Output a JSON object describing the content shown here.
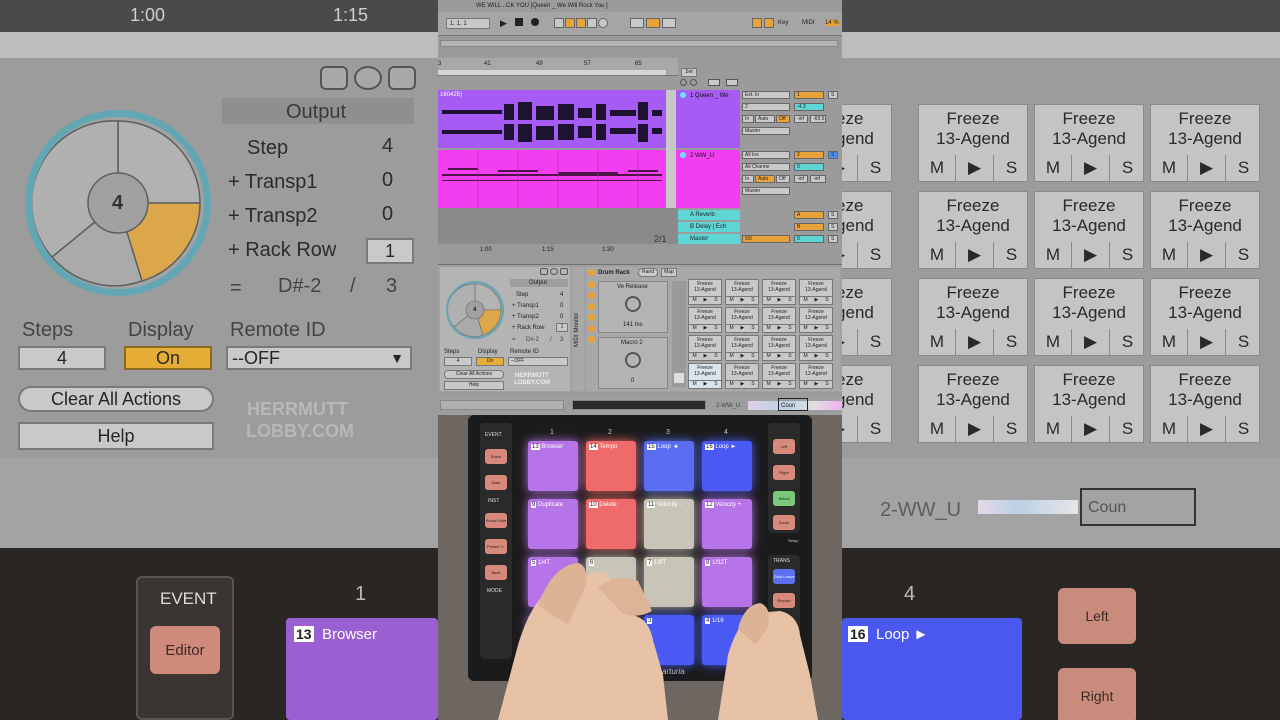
{
  "window": {
    "title": "WE WILL ..CK YOU  [Queen _ We Will Rock You ]"
  },
  "transport": {
    "position": "1.   1.   1",
    "key_label": "Key",
    "midi_label": "MIDI",
    "cpu": "14 %"
  },
  "timeline": {
    "ticks": [
      "3",
      "41",
      "49",
      "57",
      "65"
    ],
    "set_label": "Set",
    "bg_ticks": [
      "1:00",
      "1:15"
    ]
  },
  "arrangement": {
    "clip1_label": "160425)",
    "time_ticks": [
      "1:00",
      "1:15",
      "1:30"
    ],
    "fraction": "2/1"
  },
  "tracks": [
    {
      "name": "1 Queen _ We",
      "input": "Ext. In",
      "channel": "2",
      "vol": "-4.3",
      "mon_in": "In",
      "mon_auto": "Auto",
      "mon_off": "Off",
      "peak1": "-inf",
      "peak2": "-69.5",
      "out": "Master",
      "num": "1",
      "solo": "S"
    },
    {
      "name": "2 WW_U",
      "input": "All Ins",
      "channel": "All Channe",
      "vol": "0",
      "mon_in": "In",
      "mon_auto": "Auto",
      "mon_off": "Off",
      "peak1": "-inf",
      "peak2": "-inf",
      "out": "Master",
      "num": "2",
      "solo": "S"
    }
  ],
  "returns": [
    {
      "name": "A Reverb",
      "letter": "A",
      "solo": "S"
    },
    {
      "name": "B Delay | Ech",
      "letter": "B",
      "solo": "S"
    },
    {
      "name": "Master",
      "sends": "5/6",
      "vol": "0",
      "solo": "S"
    }
  ],
  "device": {
    "output_title": "Output",
    "rows": [
      {
        "label": "Step",
        "value": "4"
      },
      {
        "label": "+ Transp1",
        "value": "0"
      },
      {
        "label": "+ Transp2",
        "value": "0"
      },
      {
        "label": "+ Rack Row",
        "value": "1"
      }
    ],
    "note": "= D#-2 / 3",
    "note_name": "D#-2",
    "note_sep": "/",
    "note_num": "3",
    "eq": "=",
    "dial_value": "4",
    "steps_label": "Steps",
    "steps_value": "4",
    "display_label": "Display",
    "display_value": "On",
    "remote_label": "Remote ID",
    "remote_value": "--OFF",
    "clear_label": "Clear All Actions",
    "help_label": "Help",
    "brand_line1": "HERRMUTT",
    "brand_line2": "LOBBY.COM",
    "side_label": "MIDI Monitor"
  },
  "drum_rack": {
    "title": "Drum Rack",
    "rand": "Rand",
    "map": "Map",
    "macro1": "Ve Release",
    "macro1_value": "141 ms",
    "macro2": "Macro 2",
    "macro2_value": "0",
    "pad_name": "Freeze 13-Agend",
    "pad_top": "Freeze",
    "pad_bot": "13-Agend",
    "m": "M",
    "s": "S"
  },
  "bottom_bar": {
    "track": "2-WW_U",
    "count": "Coun"
  },
  "hardware": {
    "col_numbers": [
      "1",
      "2",
      "3",
      "4"
    ],
    "pads": [
      {
        "num": "13",
        "label": "Browser",
        "color": "#b774e8"
      },
      {
        "num": "14",
        "label": "Tempo",
        "color": "#ef6a6a"
      },
      {
        "num": "15",
        "label": "Loop ◄",
        "color": "#5a6cf2"
      },
      {
        "num": "16",
        "label": "Loop ►",
        "color": "#4a5af5"
      },
      {
        "num": "9",
        "label": "Duplicate",
        "color": "#b774e8"
      },
      {
        "num": "10",
        "label": "Delete",
        "color": "#ef6a6a"
      },
      {
        "num": "11",
        "label": "Velocity -",
        "color": "#c8c4b8"
      },
      {
        "num": "12",
        "label": "Velocity +",
        "color": "#b774e8"
      },
      {
        "num": "5",
        "label": "1/4T",
        "color": "#b774e8"
      },
      {
        "num": "6",
        "label": "",
        "color": "#c8c4b8"
      },
      {
        "num": "7",
        "label": "1/8T",
        "color": "#c8c4b8"
      },
      {
        "num": "8",
        "label": "1/32T",
        "color": "#b774e8"
      },
      {
        "num": "1",
        "label": "",
        "color": "#b774e8"
      },
      {
        "num": "2",
        "label": "",
        "color": "#c8c4b8"
      },
      {
        "num": "3",
        "label": "",
        "color": "#4a5af5"
      },
      {
        "num": "4",
        "label": "1/16",
        "color": "#4a5af5"
      }
    ],
    "left_sections": [
      "EVENT",
      "INST",
      "MODE"
    ],
    "left_buttons": [
      "Editor",
      "Mute Quantize",
      "Show/ Hide",
      "Preset +/- Next",
      "Bank"
    ],
    "right_buttons": [
      "Left",
      "Right",
      "Select",
      "Zoom"
    ],
    "setup": "Setup",
    "trans_label": "TRANS",
    "trans_buttons": [
      "Click Loops",
      "Record Start"
    ],
    "brand": "arturia"
  },
  "zoom_left": {
    "output": "Output",
    "step": "Step",
    "step_v": "4",
    "t1": "+ Transp1",
    "t1_v": "0",
    "t2": "+ Transp2",
    "t2_v": "0",
    "rr": "+ Rack Row",
    "rr_v": "1",
    "eq": "=",
    "note": "D#-2",
    "sep": "/",
    "num": "3",
    "dial": "4",
    "steps": "Steps",
    "display": "Display",
    "remote": "Remote ID",
    "steps_v": "4",
    "display_v": "On",
    "remote_v": "--OFF",
    "clear": "Clear All Actions",
    "help": "Help",
    "brand1": "HERRMUTT",
    "brand2": "LOBBY.COM",
    "event": "EVENT",
    "editor": "Editor",
    "one": "1",
    "browser": "Browser",
    "thirteen": "13"
  },
  "zoom_right": {
    "freeze": "Freeze",
    "agend": "13-Agend",
    "m": "M",
    "s": "S",
    "track": "2-WW_U",
    "count": "Coun",
    "four": "4",
    "sixteen": "16",
    "loop": "Loop ►",
    "left": "Left",
    "right": "Right"
  },
  "colors": {
    "purple": "#a75bf5",
    "magenta": "#f23ef0",
    "orange": "#f2a23a",
    "cyan": "#5fd6d6",
    "accent_ring": "#63a7b4",
    "on": "#e5ac36"
  }
}
